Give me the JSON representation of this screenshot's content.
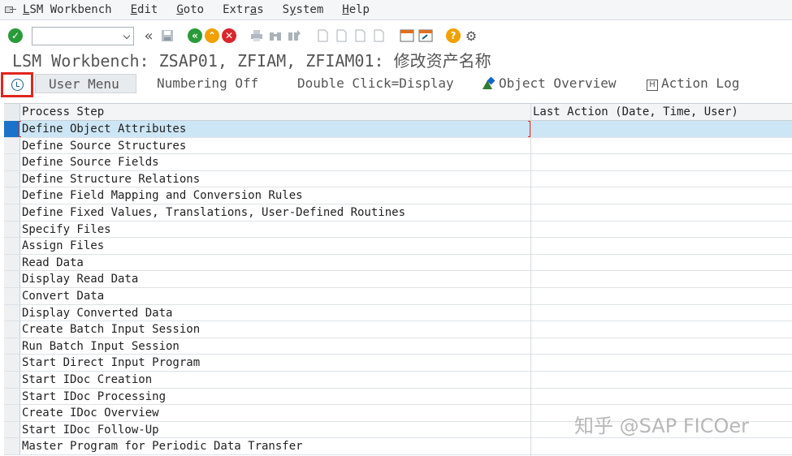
{
  "menubar": {
    "app_icon": "sap-menu-icon",
    "items": [
      {
        "label": "LSM Workbench",
        "ul_index": 0
      },
      {
        "label": "Edit",
        "ul_index": 0
      },
      {
        "label": "Goto",
        "ul_index": 0
      },
      {
        "label": "Extras",
        "ul_index": 4
      },
      {
        "label": "System",
        "ul_index": 1
      },
      {
        "label": "Help",
        "ul_index": 0
      }
    ]
  },
  "toolbar": {
    "command_field": {
      "value": "",
      "placeholder": ""
    },
    "icons": [
      "enter-check-icon",
      "double-left-arrow-icon",
      "save-icon",
      "back-icon",
      "exit-icon",
      "cancel-icon",
      "print-icon",
      "find-icon",
      "find-next-icon",
      "first-page-icon",
      "previous-page-icon",
      "next-page-icon",
      "last-page-icon",
      "new-session-icon",
      "shortcut-icon",
      "help-icon",
      "customize-layout-icon"
    ]
  },
  "title": "LSM Workbench: ZSAP01, ZFIAM, ZFIAM01: 修改资产名称",
  "appbar": {
    "execute_icon": "execute-clock-icon",
    "user_menu": "User Menu",
    "numbering": "Numbering Off",
    "double_click": "Double Click=Display",
    "object_overview": "Object Overview",
    "action_log": "Action Log",
    "action_log_icon_letter": "H"
  },
  "table": {
    "columns": [
      "Process Step",
      "Last Action (Date, Time, User)"
    ],
    "rows": [
      "Define Object Attributes",
      "Define Source Structures",
      "Define Source Fields",
      "Define Structure Relations",
      "Define Field Mapping and Conversion Rules",
      "Define Fixed Values, Translations, User-Defined Routines",
      "Specify Files",
      "Assign Files",
      "Read Data",
      "Display Read Data",
      "Convert Data",
      "Display Converted Data",
      "Create Batch Input Session",
      "Run Batch Input Session",
      "Start Direct Input Program",
      "Start IDoc Creation",
      "Start IDoc Processing",
      "Create IDoc Overview",
      "Start IDoc Follow-Up",
      "Master Program for Periodic Data Transfer"
    ],
    "selected_index": 0
  },
  "watermark": "知乎 @SAP FICOer"
}
